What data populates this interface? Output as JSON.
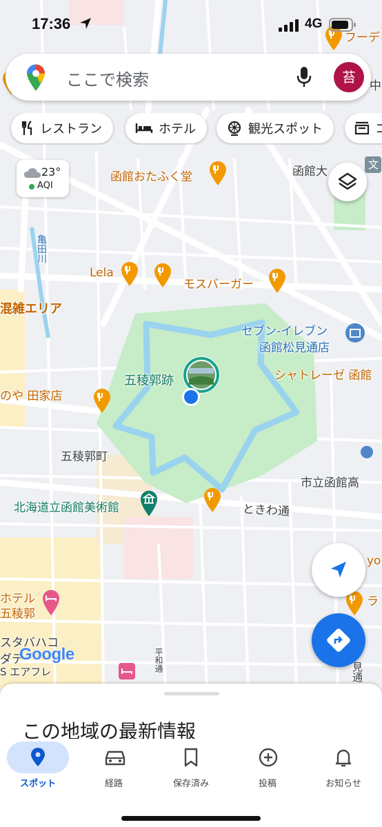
{
  "status_bar": {
    "time": "17:36",
    "network": "4G"
  },
  "search": {
    "placeholder": "ここで検索",
    "avatar_initial": "苔"
  },
  "chips": [
    {
      "label": "レストラン",
      "icon": "restaurant-icon"
    },
    {
      "label": "ホテル",
      "icon": "hotel-icon"
    },
    {
      "label": "観光スポット",
      "icon": "attraction-icon"
    },
    {
      "label": "コ",
      "icon": "shopping-icon"
    }
  ],
  "weather": {
    "temperature": "23°",
    "aqi_label": "AQI"
  },
  "map_labels": {
    "hakodate_otafuku": "函館おたふく堂",
    "hakodate_ohmachi": "函館大",
    "lela": "Lela",
    "mos_burger": "モスバーガー",
    "seven_eleven_1": "セブン-イレブン",
    "seven_eleven_2": "函館松見通店",
    "goryokaku_ato": "五稜郭跡",
    "chateraise": "シャトレーゼ 函館",
    "tagaya": "のや 田家店",
    "goryokaku_cho": "五稜郭町",
    "shiritsu_hakodate": "市立函館高",
    "museum": "北海道立函館美術館",
    "tokiwa_dori": "ときわ通",
    "hotel_goryokaku_1": "ホテル",
    "hotel_goryokaku_2": "五稜郭",
    "konzatsu_area": "混雑エリア",
    "kameda_river": "亀田川",
    "sutaba_1": "スタバハコ",
    "sutaba_2": "ダテ",
    "s_eafure": "S エアフレ",
    "heiwa_dori": "平和通",
    "mi_dori": "見通",
    "yo": "yo",
    "ra": "ラ",
    "bun": "文",
    "naka": "中",
    "fu_de": "フーデ"
  },
  "google_logo": "Google",
  "sheet": {
    "title": "この地域の最新情報"
  },
  "nav": [
    {
      "label": "スポット",
      "icon": "location-pin-icon",
      "active": true
    },
    {
      "label": "経路",
      "icon": "car-icon",
      "active": false
    },
    {
      "label": "保存済み",
      "icon": "bookmark-icon",
      "active": false
    },
    {
      "label": "投稿",
      "icon": "add-circle-icon",
      "active": false
    },
    {
      "label": "お知らせ",
      "icon": "bell-icon",
      "active": false
    }
  ],
  "colors": {
    "accent": "#1a73e8",
    "nav_active": "#0b57d0",
    "poi_orange": "#f29900",
    "park_green": "#c7ecc8",
    "water": "#9ad3ee",
    "avatar": "#b0134a"
  }
}
